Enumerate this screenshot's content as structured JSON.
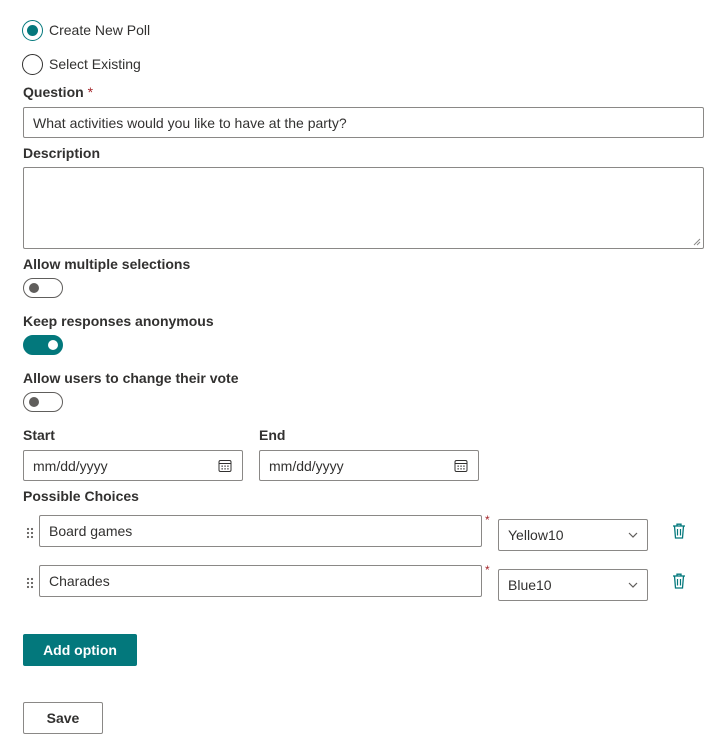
{
  "poll_mode": {
    "create_new_label": "Create New Poll",
    "select_existing_label": "Select Existing",
    "selected": "create_new"
  },
  "question": {
    "label": "Question",
    "required_marker": "*",
    "value": "What activities would you like to have at the party?"
  },
  "description": {
    "label": "Description",
    "value": ""
  },
  "settings": {
    "allow_multiple": {
      "label": "Allow multiple selections",
      "on": false
    },
    "anonymous": {
      "label": "Keep responses anonymous",
      "on": true
    },
    "change_vote": {
      "label": "Allow users to change their vote",
      "on": false
    }
  },
  "dates": {
    "start_label": "Start",
    "start_placeholder": "mm/dd/yyyy",
    "end_label": "End",
    "end_placeholder": "mm/dd/yyyy",
    "icon": "calendar-icon"
  },
  "choices": {
    "label": "Possible Choices",
    "required_marker": "*",
    "items": [
      {
        "text": "Board games",
        "color": "Yellow10"
      },
      {
        "text": "Charades",
        "color": "Blue10"
      }
    ]
  },
  "buttons": {
    "add_option": "Add option",
    "save": "Save"
  },
  "colors": {
    "accent": "#03787c",
    "required": "#a4262c",
    "border": "#8a8886"
  }
}
